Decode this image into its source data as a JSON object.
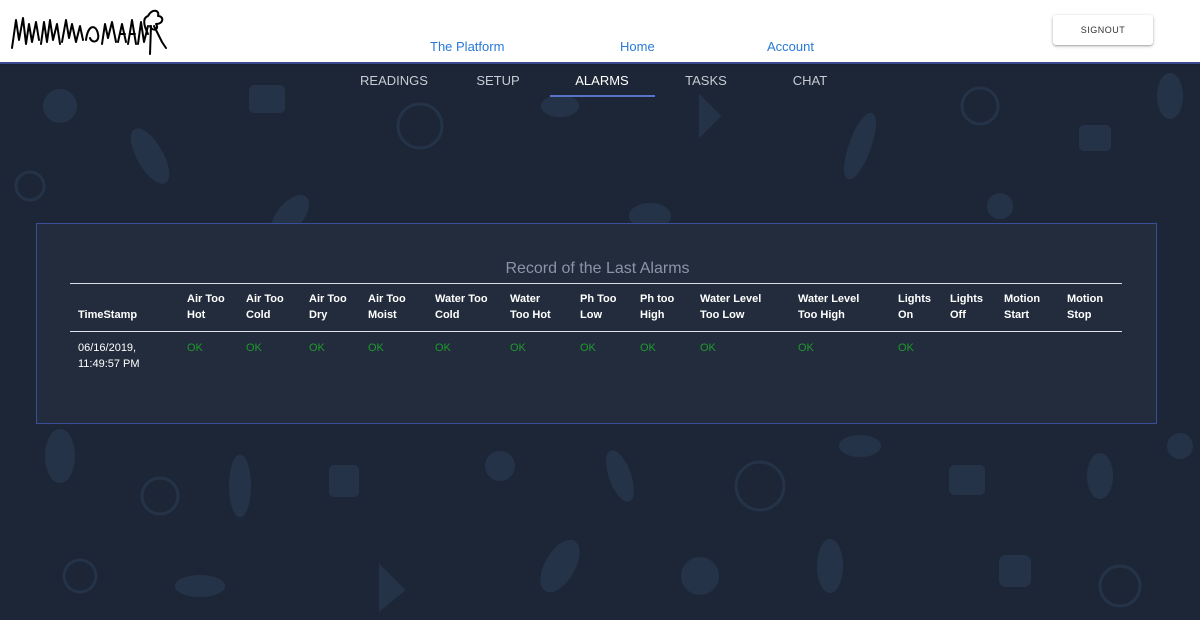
{
  "header": {
    "nav": [
      {
        "label": "The Platform"
      },
      {
        "label": "Home"
      },
      {
        "label": "Account"
      }
    ],
    "signout_label": "SIGNOUT"
  },
  "tabs": [
    {
      "label": "READINGS",
      "active": false
    },
    {
      "label": "SETUP",
      "active": false
    },
    {
      "label": "ALARMS",
      "active": true
    },
    {
      "label": "TASKS",
      "active": false
    },
    {
      "label": "CHAT",
      "active": false
    }
  ],
  "alarms": {
    "title": "Record of the Last Alarms",
    "columns": [
      {
        "line1": "",
        "line2": "TimeStamp"
      },
      {
        "line1": "Air Too",
        "line2": "Hot"
      },
      {
        "line1": "Air Too",
        "line2": "Cold"
      },
      {
        "line1": "Air Too",
        "line2": "Dry"
      },
      {
        "line1": "Air Too",
        "line2": "Moist"
      },
      {
        "line1": "Water Too",
        "line2": "Cold"
      },
      {
        "line1": "Water",
        "line2": "Too Hot"
      },
      {
        "line1": "Ph Too",
        "line2": "Low"
      },
      {
        "line1": "Ph too",
        "line2": "High"
      },
      {
        "line1": "Water Level",
        "line2": "Too Low"
      },
      {
        "line1": "Water Level",
        "line2": "Too High"
      },
      {
        "line1": "Lights",
        "line2": "On"
      },
      {
        "line1": "Lights",
        "line2": "Off"
      },
      {
        "line1": "Motion",
        "line2": "Start"
      },
      {
        "line1": "Motion",
        "line2": "Stop"
      }
    ],
    "row": {
      "timestamp_line1": "06/16/2019,",
      "timestamp_line2": "11:49:57 PM",
      "values": [
        "OK",
        "OK",
        "OK",
        "OK",
        "OK",
        "OK",
        "OK",
        "OK",
        "OK",
        "OK",
        "OK",
        "",
        "",
        ""
      ]
    }
  },
  "colors": {
    "background": "#1c2636",
    "panel": "#232c3c",
    "panel_border": "#3a4f9a",
    "link": "#2979d6",
    "ok": "#1f9a2e",
    "active_tab_indicator": "#5a73c9"
  }
}
